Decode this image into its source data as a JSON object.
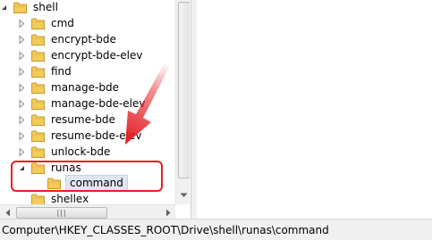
{
  "tree": {
    "items": [
      {
        "label": "shell",
        "expanded": true
      },
      {
        "label": "cmd",
        "expanded": false
      },
      {
        "label": "encrypt-bde",
        "expanded": false
      },
      {
        "label": "encrypt-bde-elev",
        "expanded": false
      },
      {
        "label": "find",
        "expanded": false
      },
      {
        "label": "manage-bde",
        "expanded": false
      },
      {
        "label": "manage-bde-elev",
        "expanded": false
      },
      {
        "label": "resume-bde",
        "expanded": false
      },
      {
        "label": "resume-bde-elev",
        "expanded": false
      },
      {
        "label": "unlock-bde",
        "expanded": false
      },
      {
        "label": "runas",
        "expanded": true
      },
      {
        "label": "command",
        "selected": true
      },
      {
        "label": "shellex"
      }
    ]
  },
  "scrollbar": {
    "hscroll_grip": "|||"
  },
  "status_bar": {
    "path": "Computer\\HKEY_CLASSES_ROOT\\Drive\\shell\\runas\\command"
  },
  "annotation": {
    "arrow_color": "#e41f26",
    "highlight_color": "#e41f26"
  },
  "icons": {
    "folder": "folder-icon",
    "expanded": "expanded-triangle-icon",
    "collapsed": "collapsed-triangle-icon"
  }
}
